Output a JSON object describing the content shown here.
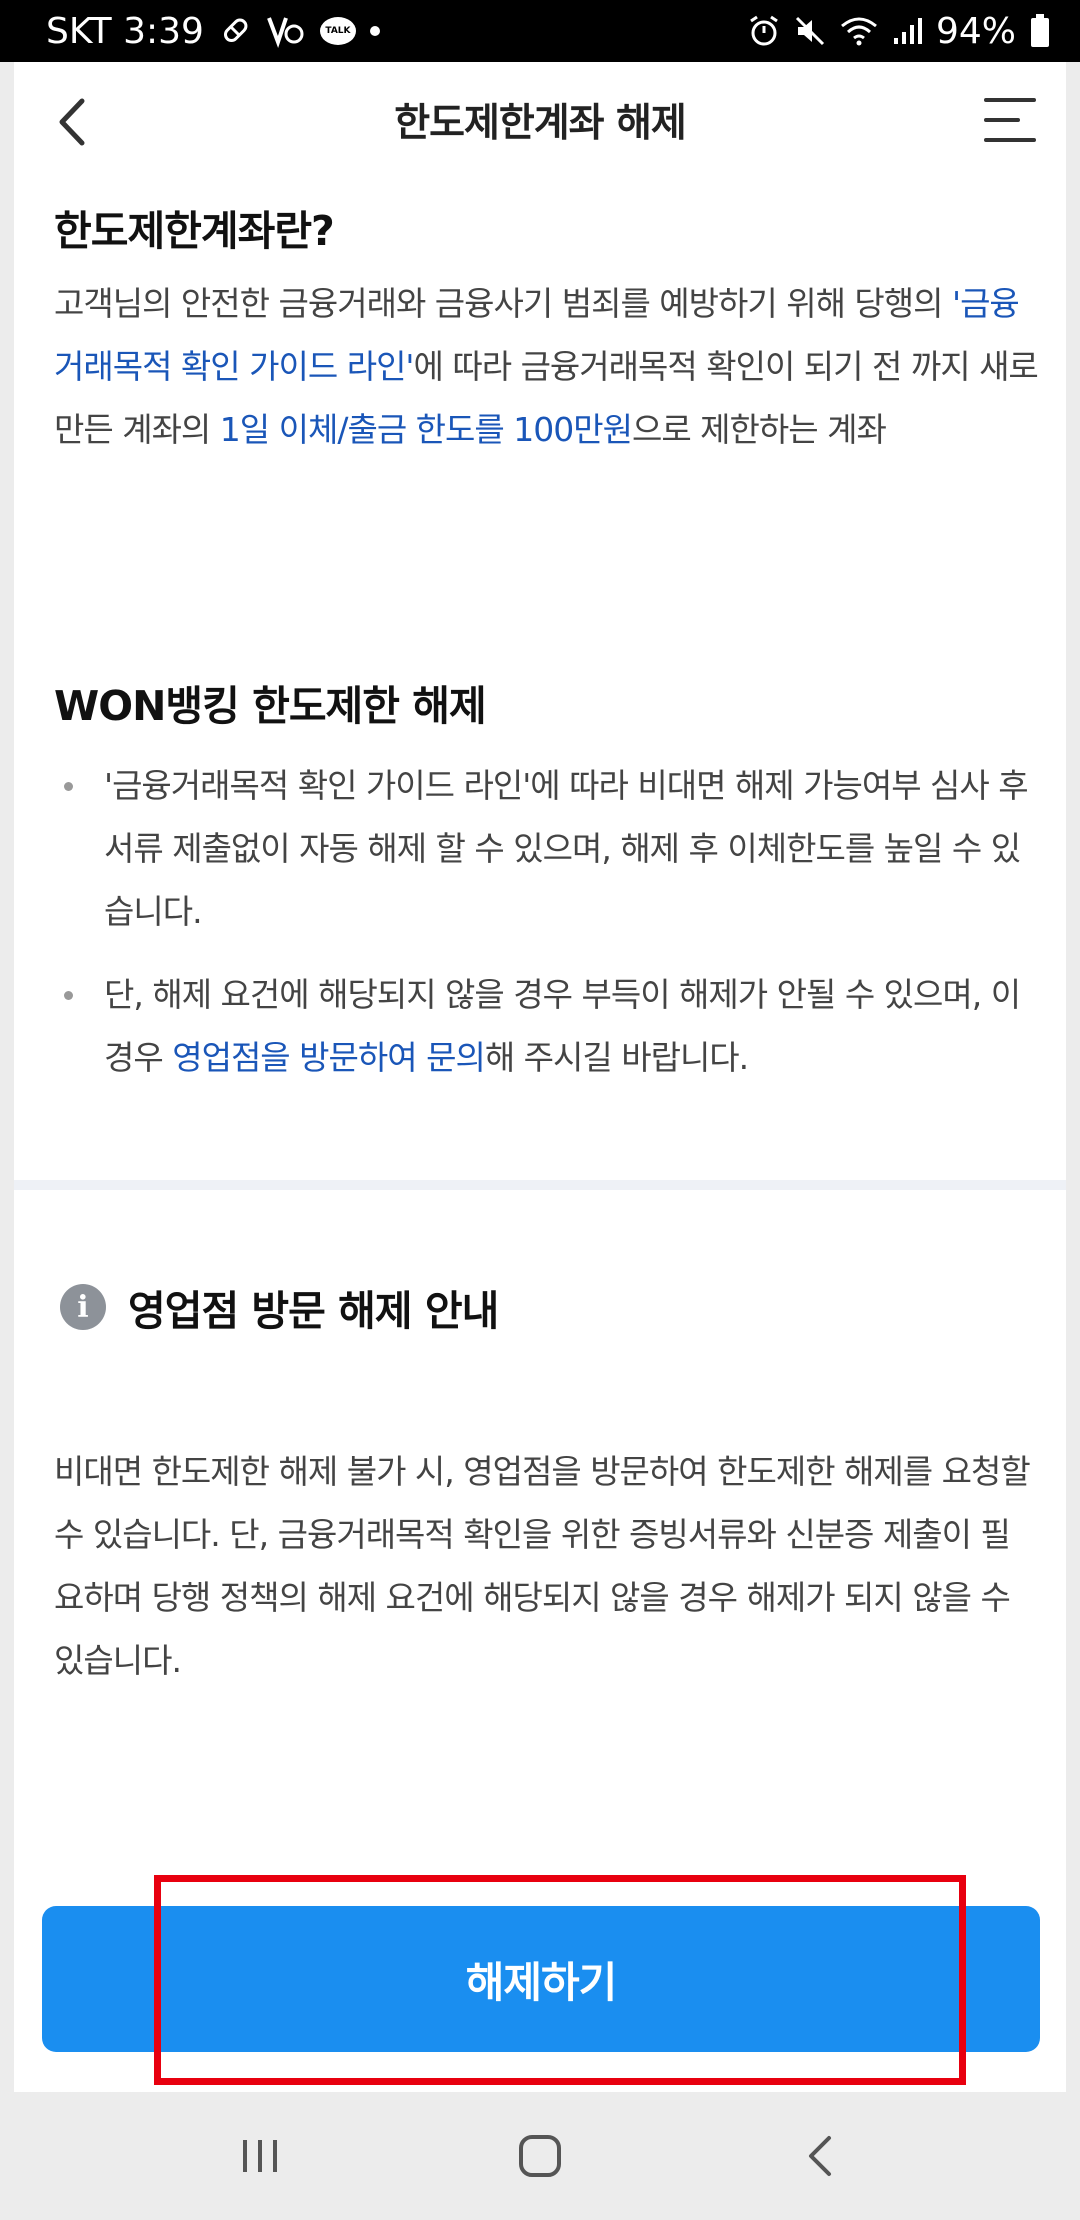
{
  "status_bar": {
    "carrier_time": "SKT 3:39",
    "talk_label": "TALK",
    "battery": "94%"
  },
  "header": {
    "title": "한도제한계좌 해제"
  },
  "section1": {
    "title": "한도제한계좌란?",
    "text_a": "고객님의 안전한 금융거래와 금융사기 범죄를 예방하기 위해 당행의 ",
    "link_guide": "'금융거래목적 확인 가이드 라인'",
    "text_b": "에 따라 금융거래목적 확인이 되기 전 까지 새로 만든 계좌의 ",
    "link_limit": "1일 이체/출금 한도를 100만원",
    "text_c": "으로 제한하는 계좌"
  },
  "section2": {
    "title": "WON뱅킹 한도제한 해제",
    "bullet1": "'금융거래목적 확인 가이드 라인'에 따라 비대면 해제 가능여부 심사 후 서류 제출없이 자동 해제 할 수 있으며, 해제 후 이체한도를 높일 수 있습니다.",
    "bullet2_a": "단, 해제 요건에 해당되지 않을 경우 부득이 해제가 안될 수 있으며, 이 경우 ",
    "bullet2_link": "영업점을 방문하여 문의",
    "bullet2_b": "해 주시길 바랍니다."
  },
  "section3": {
    "info_icon_glyph": "i",
    "title": "영업점 방문 해제 안내",
    "text": "비대면 한도제한 해제 불가 시, 영업점을 방문하여 한도제한 해제를 요청할 수 있습니다. 단, 금융거래목적 확인을 위한 증빙서류와 신분증 제출이 필요하며 당행 정책의 해제 요건에 해당되지 않을 경우 해제가 되지 않을 수 있습니다."
  },
  "action": {
    "release_button": "해제하기"
  },
  "colors": {
    "accent": "#1a8ef0",
    "link": "#1a56b8",
    "highlight": "#e8000f"
  }
}
